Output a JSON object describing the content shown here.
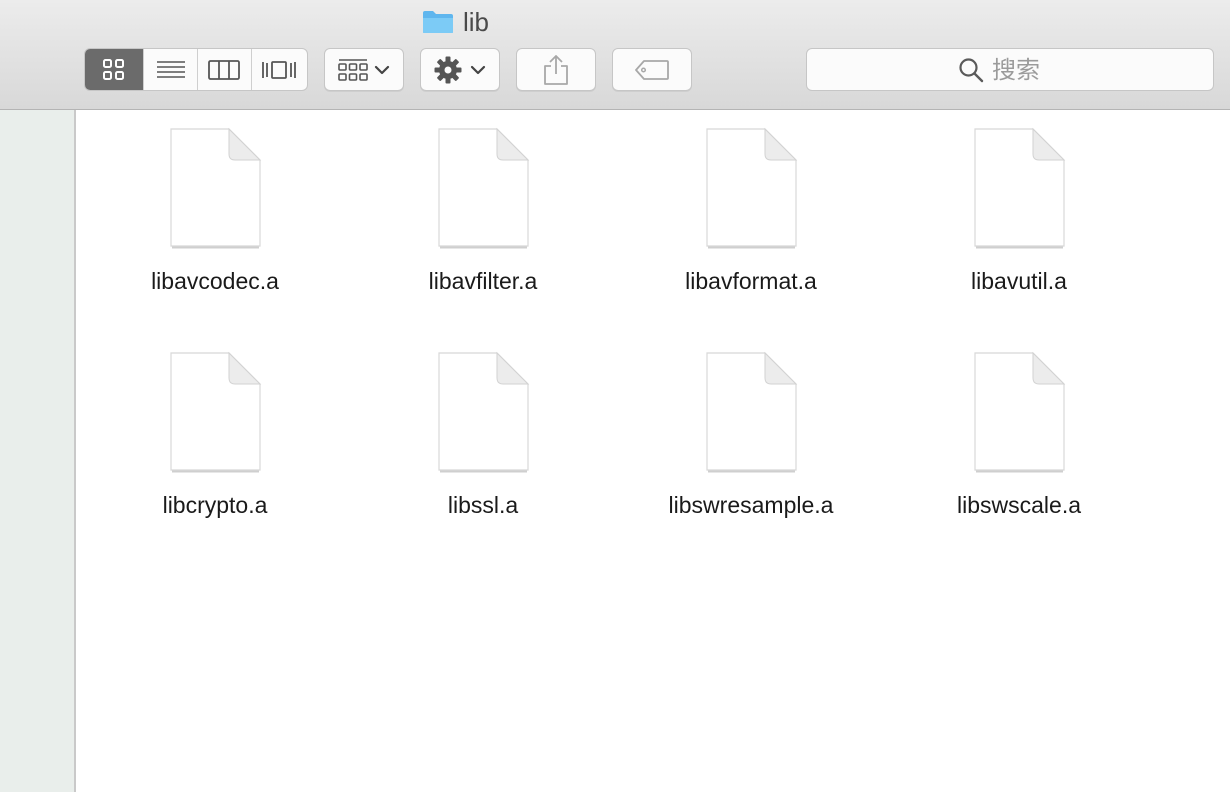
{
  "window": {
    "title": "lib",
    "title_icon": "folder-icon"
  },
  "toolbar": {
    "view_modes": [
      {
        "name": "icon-view",
        "icon": "grid-icon",
        "active": true
      },
      {
        "name": "list-view",
        "icon": "list-icon",
        "active": false
      },
      {
        "name": "column-view",
        "icon": "columns-icon",
        "active": false
      },
      {
        "name": "cover-flow-view",
        "icon": "cover-flow-icon",
        "active": false
      }
    ],
    "arrange_icon": "arrange-icon",
    "action_icon": "gear-icon",
    "share_icon": "share-icon",
    "tags_icon": "tag-icon",
    "search_placeholder": "搜索"
  },
  "files": [
    {
      "name": "libavcodec.a"
    },
    {
      "name": "libavfilter.a"
    },
    {
      "name": "libavformat.a"
    },
    {
      "name": "libavutil.a"
    },
    {
      "name": "libcrypto.a"
    },
    {
      "name": "libssl.a"
    },
    {
      "name": "libswresample.a"
    },
    {
      "name": "libswscale.a"
    }
  ],
  "colors": {
    "folder": "#6ec1f2",
    "active_segment": "#6b6b6b",
    "sidebar": "#e9eeeb"
  }
}
